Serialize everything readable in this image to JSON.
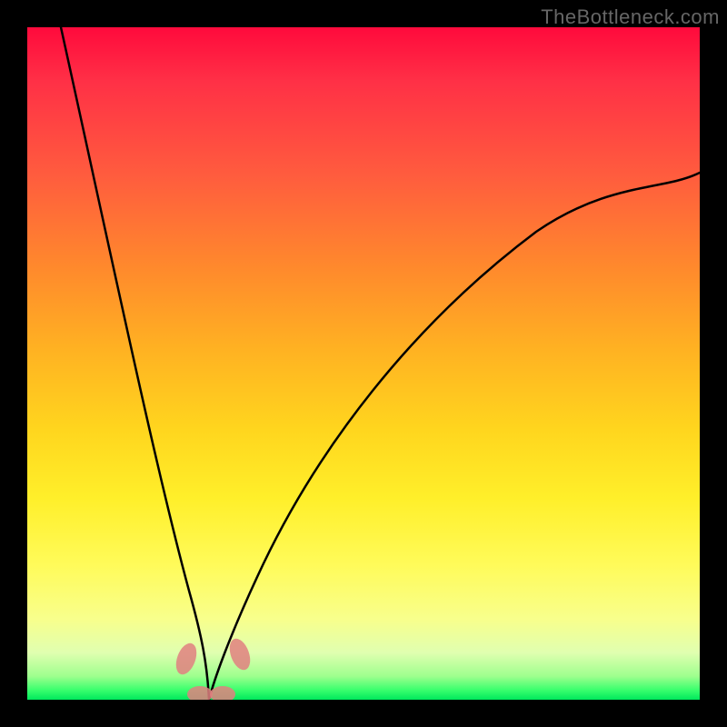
{
  "watermark": "TheBottleneck.com",
  "colors": {
    "background": "#000000",
    "curve": "#000000",
    "blob": "#e08080"
  },
  "chart_data": {
    "type": "line",
    "title": "",
    "xlabel": "",
    "ylabel": "",
    "xlim": [
      0,
      100
    ],
    "ylim": [
      0,
      100
    ],
    "note": "V-shaped bottleneck curve over a red-to-green vertical gradient. Minimum near x≈27, y≈0. Left arm rises steeply to y=100 at x≈5; right arm rises shallower to y≈78 at x=100.",
    "series": [
      {
        "name": "left-arm",
        "x": [
          5,
          10,
          15,
          20,
          24,
          26,
          27
        ],
        "values": [
          100,
          70,
          44,
          22,
          7,
          2,
          0
        ]
      },
      {
        "name": "right-arm",
        "x": [
          27,
          30,
          35,
          45,
          55,
          70,
          85,
          100
        ],
        "values": [
          0,
          3,
          10,
          28,
          42,
          58,
          70,
          78
        ]
      }
    ],
    "markers": [
      {
        "name": "left-blob",
        "x": 23,
        "y": 5
      },
      {
        "name": "bottom-blob-1",
        "x": 25,
        "y": 0.5
      },
      {
        "name": "bottom-blob-2",
        "x": 28,
        "y": 0.5
      },
      {
        "name": "right-blob",
        "x": 31,
        "y": 6
      }
    ]
  }
}
